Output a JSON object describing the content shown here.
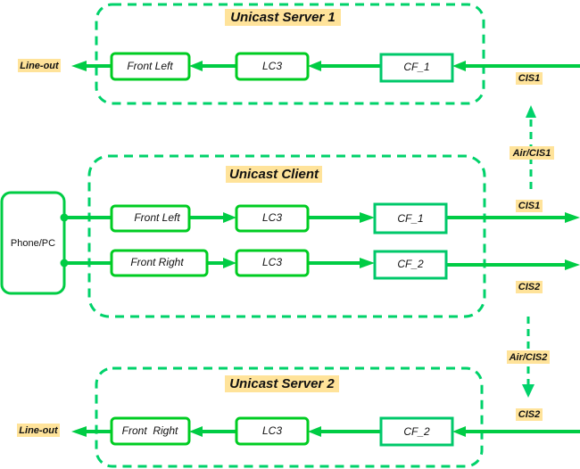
{
  "colors": {
    "accent": "#00cc44",
    "dashed": "#00d26a",
    "label_bg": "#ffe39a"
  },
  "server1": {
    "title": "Unicast Server 1",
    "front": "Front Left",
    "codec": "LC3",
    "cf": "CF_1",
    "out": "Line-out",
    "cis": "CIS1"
  },
  "air1": "Air/CIS1",
  "client": {
    "title": "Unicast Client",
    "source": "Phone/PC",
    "row1": {
      "front": "Front Left",
      "codec": "LC3",
      "cf": "CF_1",
      "cis": "CIS1"
    },
    "row2": {
      "front": "Front Right",
      "codec": "LC3",
      "cf": "CF_2",
      "cis": "CIS2"
    }
  },
  "air2": "Air/CIS2",
  "server2": {
    "title": "Unicast Server 2",
    "front": "Front  Right",
    "codec": "LC3",
    "cf": "CF_2",
    "out": "Line-out",
    "cis": "CIS2"
  }
}
